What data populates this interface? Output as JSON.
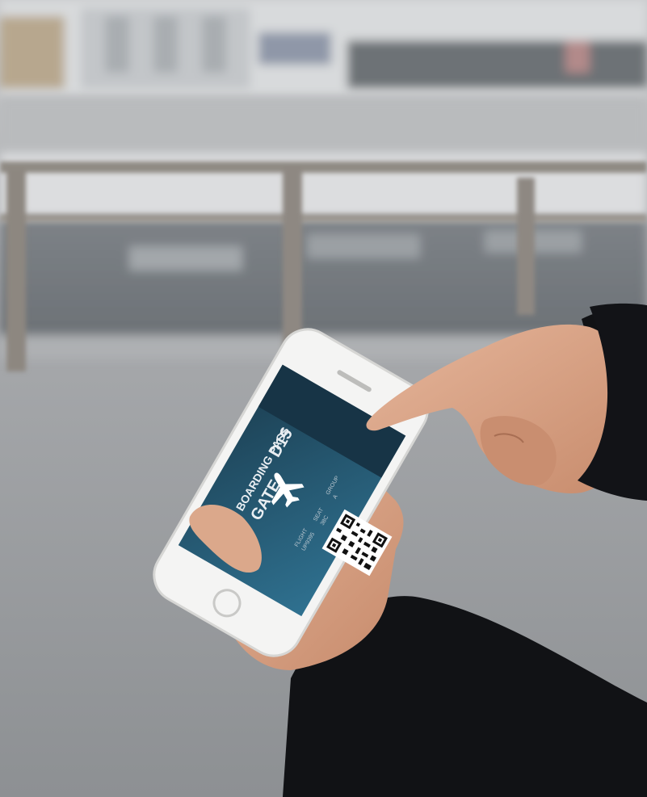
{
  "boarding_pass": {
    "title": "BOARDING PASS",
    "gate_label": "GATE",
    "gate_value": "D15",
    "field_flight": "FLIGHT",
    "field_flight_value": "UP9395",
    "field_seat": "SEAT",
    "field_seat_value": "38C",
    "field_group": "GROUP",
    "field_group_value": "A"
  },
  "icons": {
    "airplane": "airplane-icon",
    "qr": "qr-code-icon",
    "home_button": "home-button-icon"
  },
  "colors": {
    "screen_top": "#1f4a5e",
    "screen_bottom": "#2d6b86",
    "sleeve": "#101114",
    "skin": "#d9a487",
    "pavement": "#9c9fa2"
  }
}
